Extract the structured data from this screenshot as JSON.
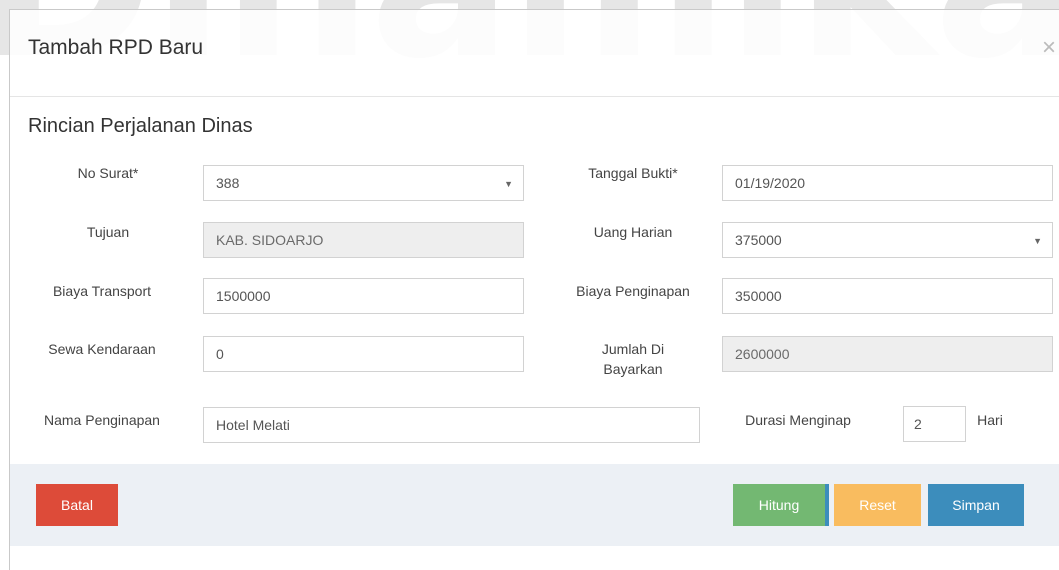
{
  "watermark": {
    "text": "Dinamika"
  },
  "modal": {
    "title": "Tambah RPD Baru",
    "close_symbol": "×"
  },
  "section": {
    "title": "Rincian Perjalanan Dinas"
  },
  "fields": {
    "no_surat": {
      "label": "No Surat*",
      "value": "388"
    },
    "tanggal_bukti": {
      "label": "Tanggal Bukti*",
      "value": "01/19/2020"
    },
    "tujuan": {
      "label": "Tujuan",
      "value": "KAB. SIDOARJO"
    },
    "uang_harian": {
      "label": "Uang Harian",
      "value": "375000"
    },
    "biaya_transport": {
      "label": "Biaya Transport",
      "value": "1500000"
    },
    "biaya_penginapan": {
      "label": "Biaya Penginapan",
      "value": "350000"
    },
    "sewa_kendaraan": {
      "label": "Sewa Kendaraan",
      "value": "0"
    },
    "jumlah_dibayarkan": {
      "label_line1": "Jumlah Di",
      "label_line2": "Bayarkan",
      "value": "2600000"
    },
    "nama_penginapan": {
      "label": "Nama Penginapan",
      "value": "Hotel Melati"
    },
    "durasi_menginap": {
      "label": "Durasi Menginap",
      "value": "2",
      "unit": "Hari"
    }
  },
  "buttons": {
    "batal": "Batal",
    "hitung": "Hitung",
    "reset": "Reset",
    "simpan": "Simpan"
  },
  "colors": {
    "batal": "#dd4b39",
    "hitung": "#73b872",
    "reset": "#f9bc5f",
    "simpan": "#3c8dbc",
    "footer": "#ecf0f5"
  }
}
